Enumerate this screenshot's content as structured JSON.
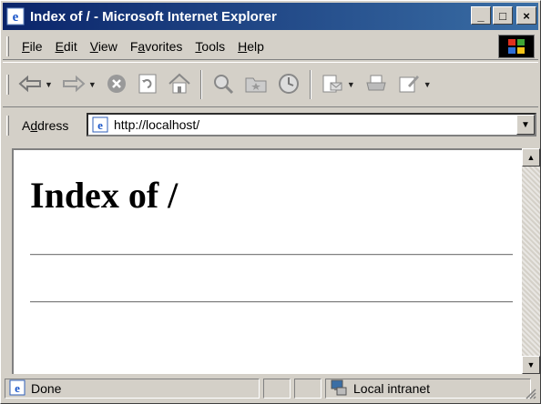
{
  "window": {
    "title": "Index of / - Microsoft Internet Explorer",
    "minimize_glyph": "_",
    "maximize_glyph": "□",
    "close_glyph": "×"
  },
  "menubar": {
    "items": [
      {
        "label_ul": "F",
        "label_rest": "ile"
      },
      {
        "label_ul": "E",
        "label_rest": "dit"
      },
      {
        "label_ul": "V",
        "label_rest": "iew"
      },
      {
        "label_ul": "",
        "label_pre": "F",
        "label_mid": "a",
        "label_rest": "vorites"
      },
      {
        "label_ul": "T",
        "label_rest": "ools"
      },
      {
        "label_ul": "H",
        "label_rest": "elp"
      }
    ]
  },
  "toolbar": {
    "icons": [
      "back-icon",
      "forward-icon",
      "stop-icon",
      "refresh-icon",
      "home-icon",
      "search-icon",
      "favorites-icon",
      "history-icon",
      "mail-icon",
      "print-icon",
      "edit-icon"
    ]
  },
  "address": {
    "label_pre": "A",
    "label_ul": "d",
    "label_rest": "dress",
    "url": "http://localhost/"
  },
  "page": {
    "heading": "Index of /"
  },
  "status": {
    "text": "Done",
    "zone": "Local intranet"
  },
  "colors": {
    "title_bar_start": "#0a246a",
    "title_bar_end": "#3a6ea5",
    "chrome": "#d4d0c8"
  }
}
